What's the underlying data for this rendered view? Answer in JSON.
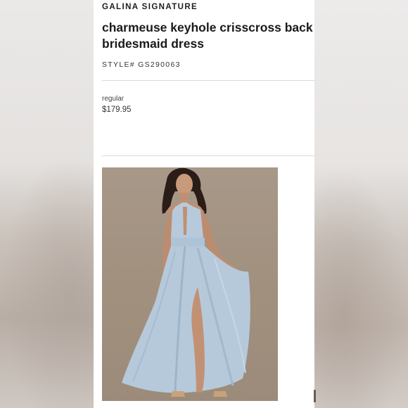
{
  "product": {
    "brand": "GALINA SIGNATURE",
    "title": "charmeuse keyhole crisscross back bridesmaid dress",
    "style_number": "STYLE# GS290063",
    "price_label": "regular",
    "price": "$179.95"
  },
  "image": {
    "icon": "product-photo",
    "description_color": "#b9cbdb"
  },
  "colors": {
    "page_background": "#ffffff",
    "text": "#1a1a1a",
    "divider": "#d9d9d9",
    "dress": "#b9cbdb",
    "photo_background": "#a2917f"
  }
}
